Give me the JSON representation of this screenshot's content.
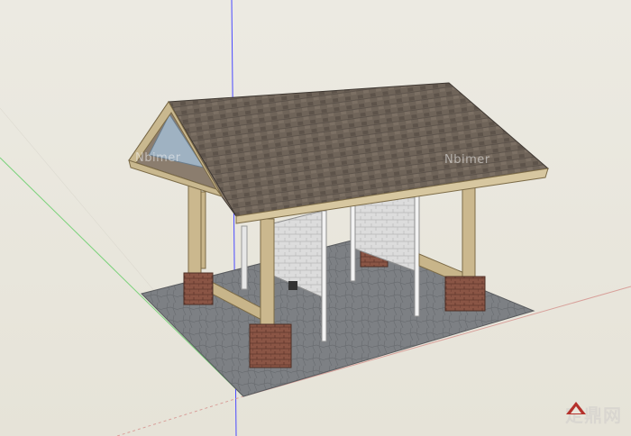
{
  "viewport": {
    "watermark_left": "Nbimer",
    "watermark_right": "Nbimer",
    "brand_text": "定鼎网"
  },
  "colors": {
    "sky": "#e9e6dc",
    "ground_slab": "#7f8185",
    "roof": "#6e6258",
    "timber": "#c8b58a",
    "brick": "#8a5545",
    "stone_wall": "#d7d7d7",
    "axis_red": "#d8a09a",
    "axis_green": "#7bd27b",
    "axis_blue": "#4a4aff"
  },
  "icons": [
    "brand-logo-icon"
  ]
}
